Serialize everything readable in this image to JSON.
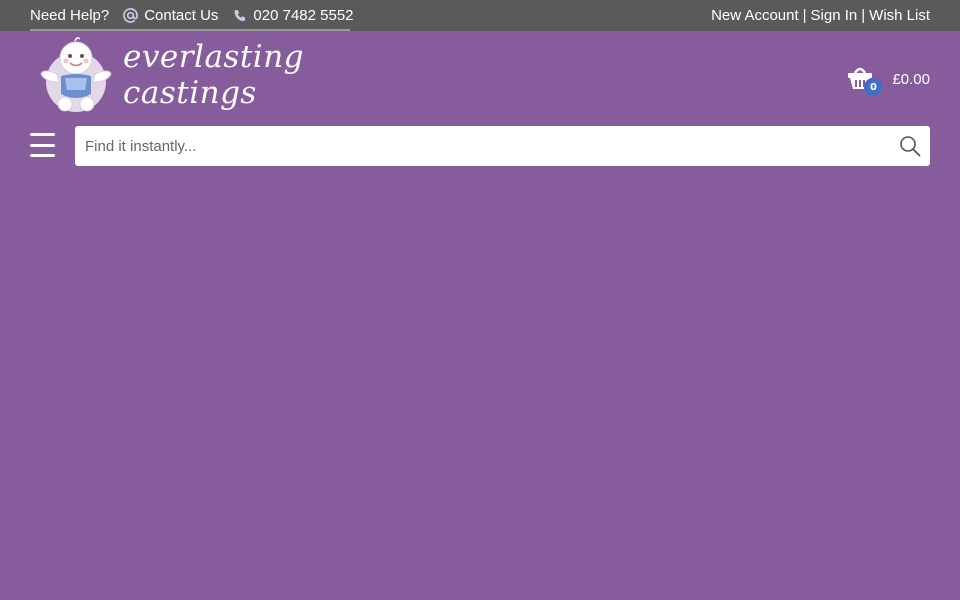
{
  "topbar": {
    "need_help": "Need Help?",
    "contact_label": "Contact Us",
    "phone": "020 7482 5552",
    "new_account": "New Account",
    "separator": "|",
    "sign_in": "Sign In",
    "wish_list": "Wish List"
  },
  "logo": {
    "text": "everlasting castings"
  },
  "cart": {
    "count": "0",
    "total": "£0.00"
  },
  "search": {
    "placeholder": "Find it instantly..."
  },
  "colors": {
    "background": "#865c9c",
    "topbar": "#5a5a5a",
    "badge": "#3f6fc4"
  }
}
